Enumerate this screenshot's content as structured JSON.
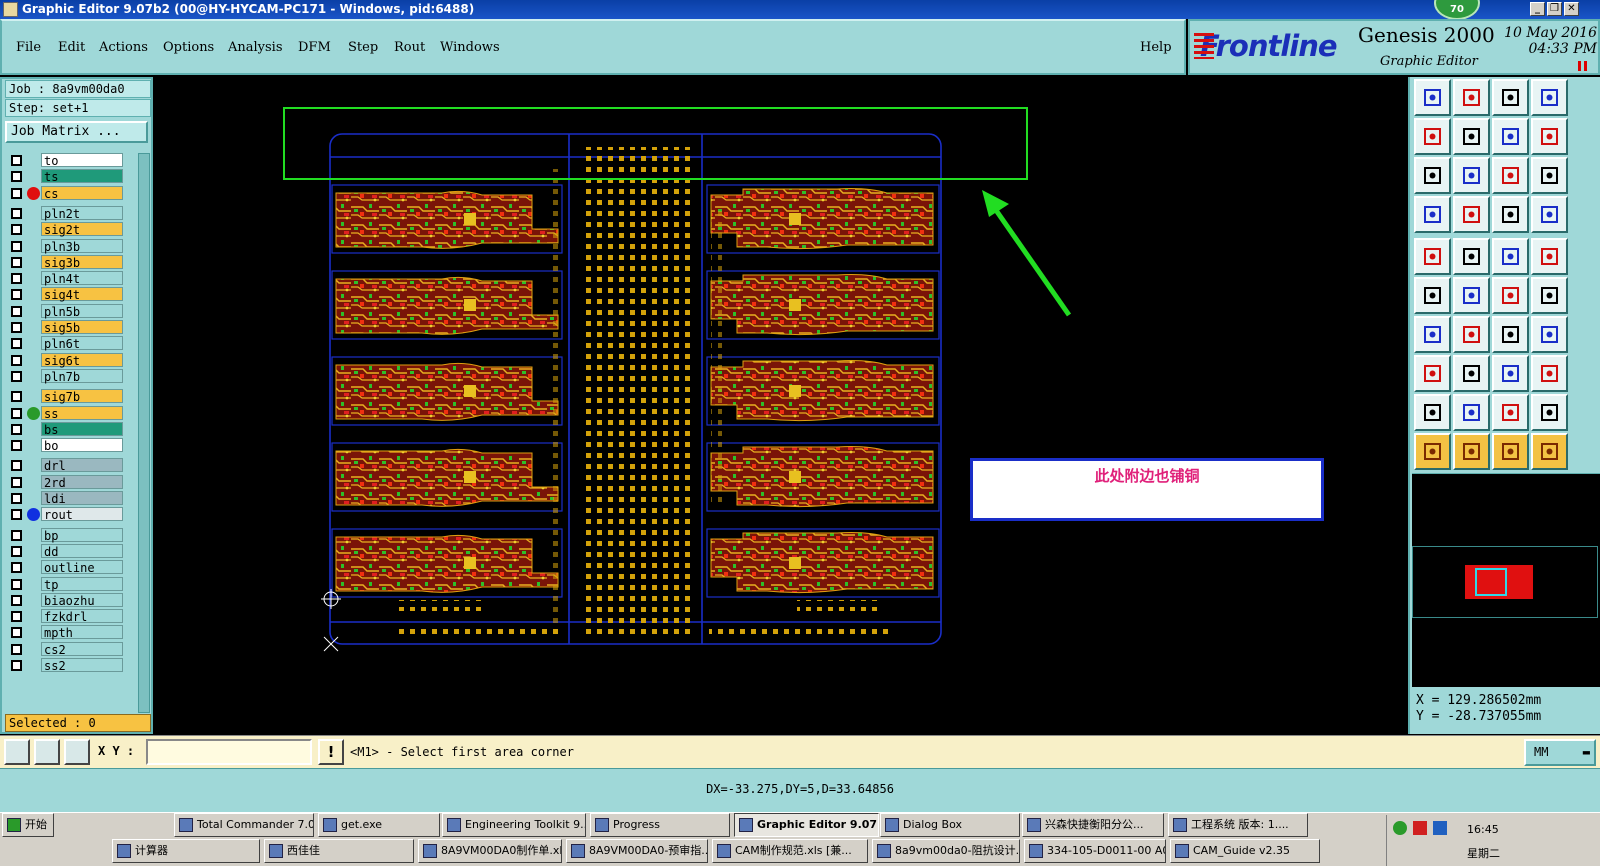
{
  "window": {
    "title": "Graphic Editor 9.07b2 (00@HY-HYCAM-PC171 - Windows, pid:6488)",
    "badge": "70"
  },
  "menu": {
    "items": [
      "File",
      "Edit",
      "Actions",
      "Options",
      "Analysis",
      "DFM",
      "Step",
      "Rout",
      "Windows"
    ],
    "help": "Help"
  },
  "brand": {
    "logo": "Frontline",
    "product": "Genesis 2000",
    "subtitle": "Graphic Editor",
    "date": "10 May 2016",
    "time": "04:33 PM"
  },
  "job": {
    "job_line": "Job : 8a9vm00da0",
    "step_line": "Step: set+1",
    "matrix_button": "Job Matrix ...",
    "selected": "Selected : 0"
  },
  "layers": [
    {
      "name": "to",
      "color": "#ffffff",
      "dot": ""
    },
    {
      "name": "ts",
      "color": "#1f9a7a",
      "dot": ""
    },
    {
      "name": "cs",
      "color": "#f7c242",
      "dot": "#e01010"
    },
    {
      "name": "pln2t",
      "color": "#9fd8d8",
      "dot": ""
    },
    {
      "name": "sig2t",
      "color": "#f7c242",
      "dot": ""
    },
    {
      "name": "pln3b",
      "color": "#9fd8d8",
      "dot": ""
    },
    {
      "name": "sig3b",
      "color": "#f7c242",
      "dot": ""
    },
    {
      "name": "pln4t",
      "color": "#9fd8d8",
      "dot": ""
    },
    {
      "name": "sig4t",
      "color": "#f7c242",
      "dot": ""
    },
    {
      "name": "pln5b",
      "color": "#9fd8d8",
      "dot": ""
    },
    {
      "name": "sig5b",
      "color": "#f7c242",
      "dot": ""
    },
    {
      "name": "pln6t",
      "color": "#9fd8d8",
      "dot": ""
    },
    {
      "name": "sig6t",
      "color": "#f7c242",
      "dot": ""
    },
    {
      "name": "pln7b",
      "color": "#9fd8d8",
      "dot": ""
    },
    {
      "name": "sig7b",
      "color": "#f7c242",
      "dot": ""
    },
    {
      "name": "ss",
      "color": "#f7c242",
      "dot": "#2a9a2a"
    },
    {
      "name": "bs",
      "color": "#1f9a7a",
      "dot": ""
    },
    {
      "name": "bo",
      "color": "#ffffff",
      "dot": ""
    },
    {
      "name": "drl",
      "color": "#9ab8c0",
      "dot": ""
    },
    {
      "name": "2rd",
      "color": "#9ab8c0",
      "dot": ""
    },
    {
      "name": "ldi",
      "color": "#9ab8c0",
      "dot": ""
    },
    {
      "name": "rout",
      "color": "#dfe8ea",
      "dot": "#1030e0"
    },
    {
      "name": "bp",
      "color": "#9fd8d8",
      "dot": ""
    },
    {
      "name": "dd",
      "color": "#9fd8d8",
      "dot": ""
    },
    {
      "name": "outline",
      "color": "#9fd8d8",
      "dot": ""
    },
    {
      "name": "tp",
      "color": "#9fd8d8",
      "dot": ""
    },
    {
      "name": "biaozhu",
      "color": "#9fd8d8",
      "dot": ""
    },
    {
      "name": "fzkdrl",
      "color": "#9fd8d8",
      "dot": ""
    },
    {
      "name": "mpth",
      "color": "#9fd8d8",
      "dot": ""
    },
    {
      "name": "cs2",
      "color": "#9fd8d8",
      "dot": ""
    },
    {
      "name": "ss2",
      "color": "#9fd8d8",
      "dot": ""
    }
  ],
  "annotation": {
    "note": "此处附边也铺铜",
    "note_color": "#e0207a",
    "frame_color": "#22dd22",
    "arrow_color": "#22dd22"
  },
  "coords": {
    "x": "X = 129.286502mm",
    "y": "Y = -28.737055mm"
  },
  "bottom": {
    "xy_label": "X Y :",
    "xy_value": "",
    "excl": "!",
    "prompt": "<M1> - Select first area corner",
    "units": "MM",
    "measure": "DX=-33.275,DY=5,D=33.64856"
  },
  "taskbar": {
    "start": "开始",
    "row1": [
      "Total Commander 7.0 ...",
      "get.exe",
      "Engineering Toolkit 9....",
      "Progress",
      "Graphic Editor 9.07...",
      "Dialog Box",
      "兴森快捷衡阳分公...",
      "工程系统 版本: 1...."
    ],
    "row2": [
      "计算器",
      "西佳佳",
      "8A9VM00DA0制作单.xl...",
      "8A9VM00DA0-预审指...",
      "CAM制作规范.xls [兼...",
      "8a9vm00da0-阻抗设计...",
      "334-105-D0011-00 A0 ...",
      "CAM_Guide v2.35"
    ],
    "clock": "16:45",
    "day": "星期二"
  },
  "colors": {
    "panel": "#9fd8d8",
    "selected_bg": "#f7c242",
    "pad": "#d4a20a",
    "outline": "#1a2ec8"
  }
}
